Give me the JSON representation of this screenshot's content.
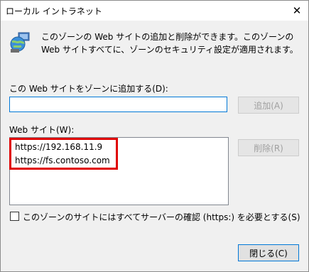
{
  "window": {
    "title": "ローカル イントラネット",
    "close_glyph": "✕"
  },
  "description": "このゾーンの Web サイトの追加と削除ができます。このゾーンの Web サイトすべてに、ゾーンのセキュリティ設定が適用されます。",
  "add_section": {
    "label": "この Web サイトをゾーンに追加する(D):",
    "input_value": "",
    "add_button": "追加(A)"
  },
  "sites_section": {
    "label": "Web サイト(W):",
    "sites": [
      "https://192.168.11.9",
      "https://fs.contoso.com"
    ],
    "remove_button": "削除(R)"
  },
  "https_checkbox": {
    "label": "このゾーンのサイトにはすべてサーバーの確認 (https:) を必要とする(S)",
    "checked": false
  },
  "close_button": "閉じる(C)",
  "icons": {
    "zone_icon": "globe-network-icon"
  },
  "colors": {
    "highlight_box": "#e00000",
    "focus_border": "#0078d7"
  }
}
